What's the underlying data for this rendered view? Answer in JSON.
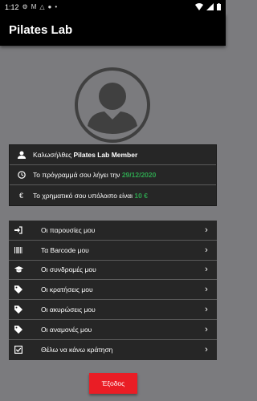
{
  "status_bar": {
    "time": "1:12"
  },
  "app_bar": {
    "title": "Pilates Lab"
  },
  "info": {
    "welcome_prefix": "Καλωσήλθες",
    "member_name": "Pilates Lab Member",
    "program_prefix": "Το πρόγραμμά σου λήγει την",
    "program_date": "29/12/2020",
    "balance_prefix": "Το χρηματικό σου υπόλοιπο είναι",
    "balance_value": "10 €"
  },
  "menu": {
    "items": [
      {
        "label": "Οι παρουσίες μου",
        "icon": "sign-in-icon"
      },
      {
        "label": "Τα Barcode μου",
        "icon": "barcode-icon"
      },
      {
        "label": "Οι συνδρομές μου",
        "icon": "graduation-cap-icon"
      },
      {
        "label": "Οι κρατήσεις μου",
        "icon": "tag-icon"
      },
      {
        "label": "Οι ακυρώσεις μου",
        "icon": "tag-icon"
      },
      {
        "label": "Οι αναμονές μου",
        "icon": "tag-icon"
      },
      {
        "label": "Θέλω να κάνω κράτηση",
        "icon": "check-square-icon"
      }
    ]
  },
  "logout_label": "Έξοδος",
  "colors": {
    "accent_green": "#2ea44f",
    "logout_red": "#ea1d25",
    "background": "#7b7b7e",
    "card": "#262626"
  }
}
